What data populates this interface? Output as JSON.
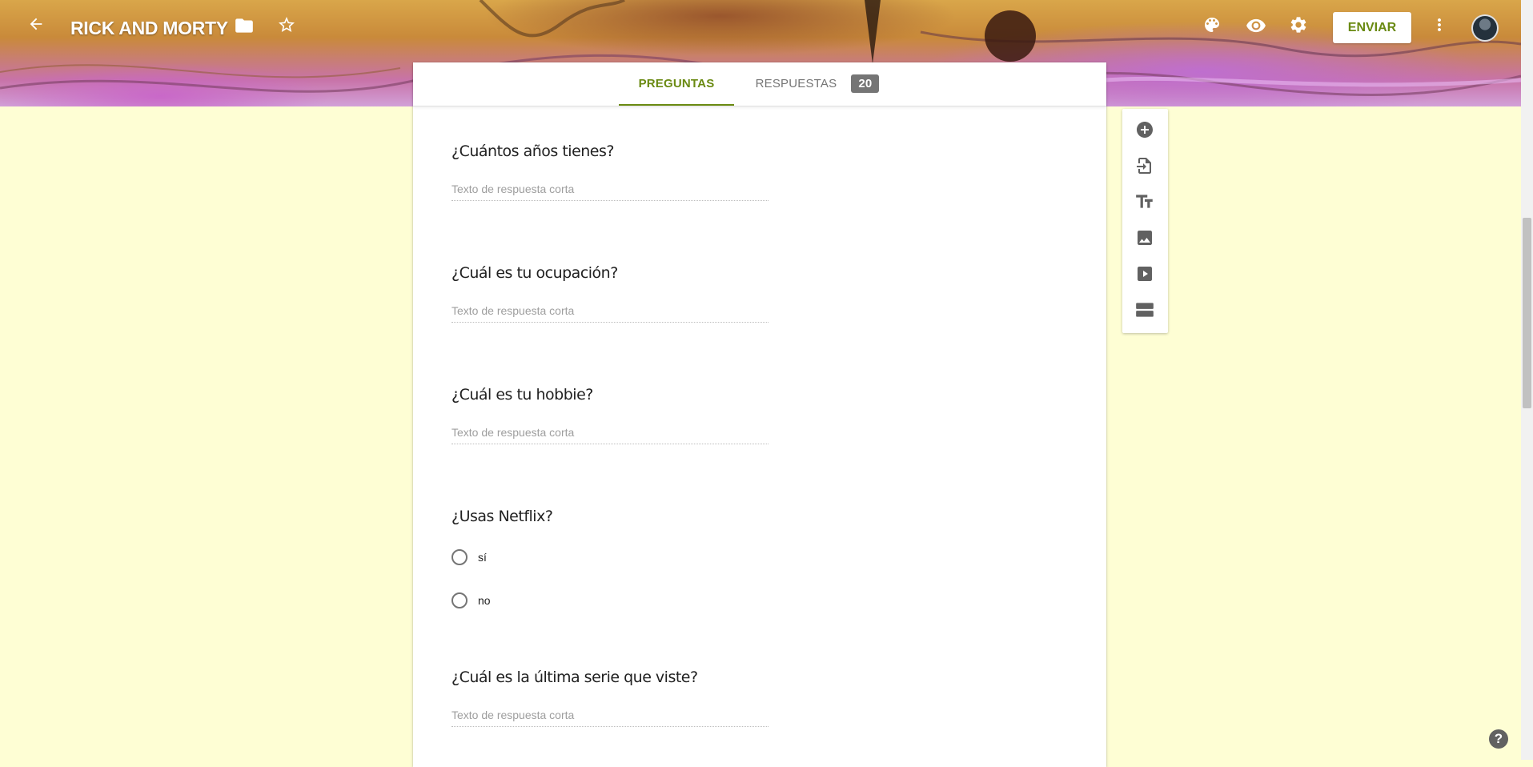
{
  "header": {
    "title": "RICK AND MORTY",
    "send_label": "ENVIAR",
    "icons": [
      "arrow-back-icon",
      "folder-icon",
      "star-icon",
      "palette-icon",
      "eye-icon",
      "gear-icon",
      "more-vert-icon"
    ]
  },
  "tabs": {
    "questions_label": "PREGUNTAS",
    "responses_label": "RESPUESTAS",
    "responses_count": "20"
  },
  "questions": [
    {
      "title": "¿Cuántos años tienes?",
      "type": "short",
      "placeholder": "Texto de respuesta corta"
    },
    {
      "title": "¿Cuál es tu ocupación?",
      "type": "short",
      "placeholder": "Texto de respuesta corta"
    },
    {
      "title": "¿Cuál es tu hobbie?",
      "type": "short",
      "placeholder": "Texto de respuesta corta"
    },
    {
      "title": "¿Usas Netflix?",
      "type": "radio",
      "options": [
        "sí",
        "no"
      ]
    },
    {
      "title": "¿Cuál es la última serie que viste?",
      "type": "short",
      "placeholder": "Texto de respuesta corta"
    }
  ],
  "toolbar": {
    "icons": [
      "add-question-icon",
      "import-questions-icon",
      "add-title-icon",
      "add-image-icon",
      "add-video-icon",
      "add-section-icon"
    ]
  },
  "help_label": "?",
  "colors": {
    "accent": "#6a8a12",
    "background": "#fefed4"
  }
}
